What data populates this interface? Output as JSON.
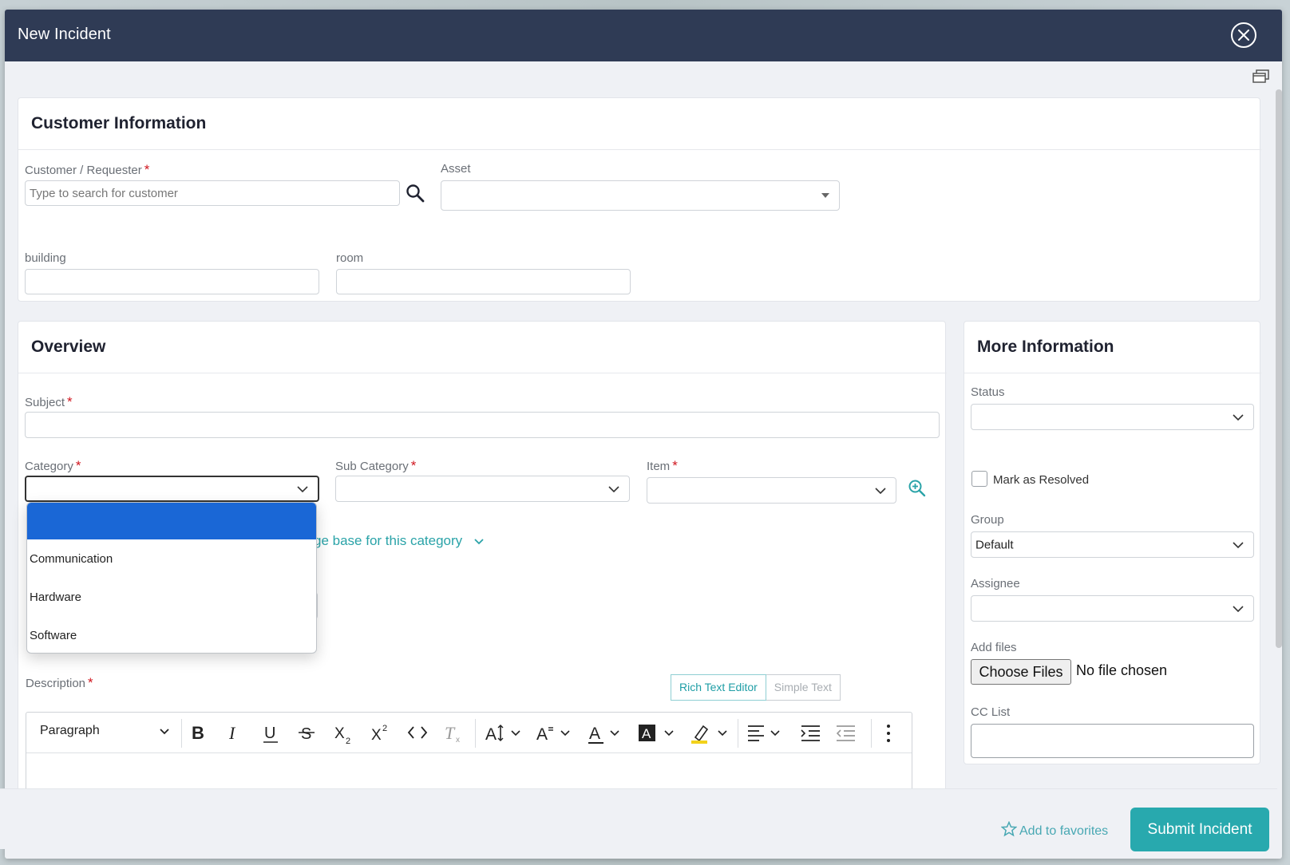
{
  "modal": {
    "title": "New Incident"
  },
  "customer_info": {
    "title": "Customer Information",
    "customer_label": "Customer / Requester",
    "customer_placeholder": "Type to search for customer",
    "asset_label": "Asset",
    "building_label": "building",
    "room_label": "room"
  },
  "overview": {
    "title": "Overview",
    "subject_label": "Subject",
    "category_label": "Category",
    "subcategory_label": "Sub Category",
    "item_label": "Item",
    "kb_link": "ge base for this category",
    "description_label": "Description",
    "category_options": [
      "",
      "Communication",
      "Hardware",
      "Software"
    ],
    "editor_modes": {
      "rich": "Rich Text Editor",
      "simple": "Simple Text"
    },
    "toolbar": {
      "paragraph": "Paragraph"
    }
  },
  "more_info": {
    "title": "More Information",
    "status_label": "Status",
    "mark_resolved": "Mark as Resolved",
    "group_label": "Group",
    "group_value": "Default",
    "assignee_label": "Assignee",
    "add_files_label": "Add files",
    "choose_files": "Choose Files",
    "no_file": "No file chosen",
    "cc_label": "CC List"
  },
  "footer": {
    "favorites": "Add to favorites",
    "submit": "Submit Incident"
  },
  "colors": {
    "header": "#2f3b55",
    "accent": "#28a9ae",
    "required": "#d0161f",
    "selected_option": "#1a67d6"
  }
}
